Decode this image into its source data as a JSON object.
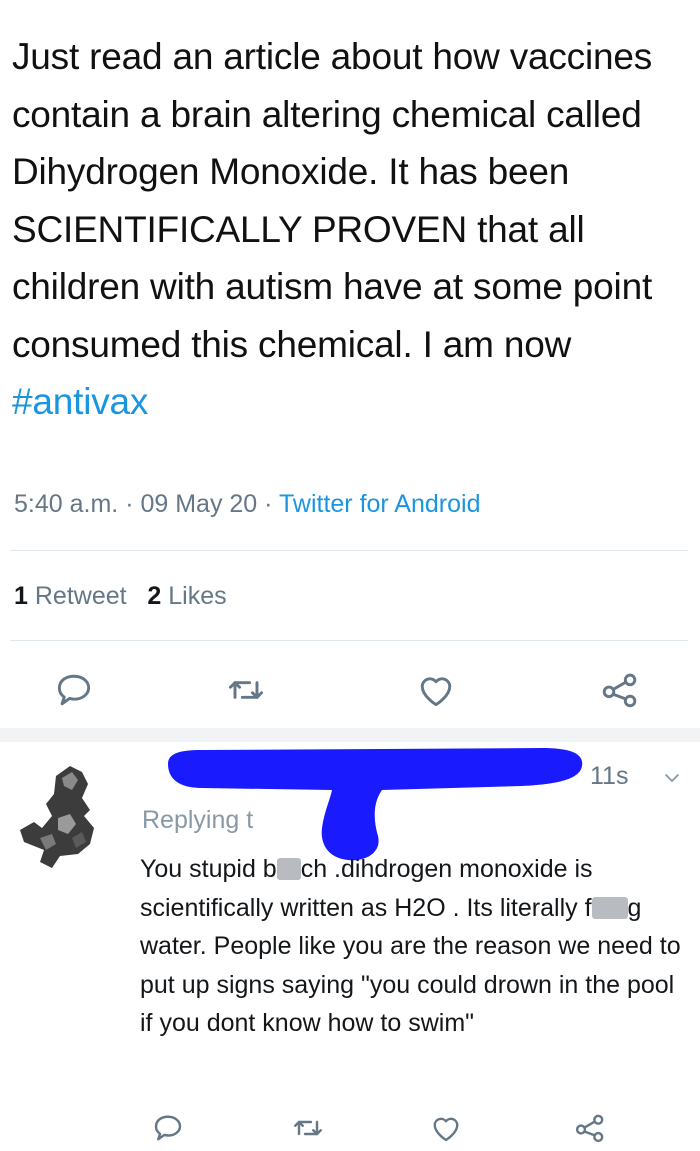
{
  "tweet": {
    "text": "Just read an article about how vaccines contain a brain altering chemical called Dihydrogen Monoxide. It has been SCIENTIFICALLY PROVEN that all children with autism have at some point consumed this chemical. I am now ",
    "hashtag": "#antivax",
    "time": "5:40 a.m.",
    "date": "09 May 20",
    "source": "Twitter for Android",
    "retweet_count": "1",
    "retweet_label": "Retweet",
    "likes_count": "2",
    "likes_label": "Likes"
  },
  "actions": [
    {
      "icon": "reply-icon"
    },
    {
      "icon": "retweet-icon"
    },
    {
      "icon": "like-icon"
    },
    {
      "icon": "share-icon"
    }
  ],
  "reply": {
    "time": "11s",
    "replying_prefix": "Replying t",
    "text_1": "You stupid b",
    "text_2": "ch .dihdrogen monoxide is scientifically written as H2O . Its literally f",
    "text_3": "g water. People like you are the reason we need to put up signs saying \"you could drown in the pool if you dont know how to swim\""
  },
  "colors": {
    "link": "#1b95e0",
    "meta": "#657786",
    "redaction": "#1a1aff",
    "icon": "#657786"
  }
}
